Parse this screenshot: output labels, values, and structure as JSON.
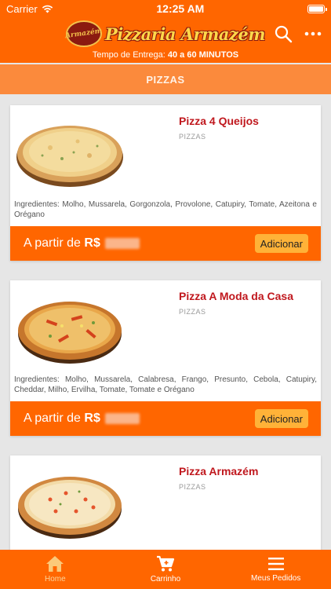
{
  "status_bar": {
    "carrier": "Carrier",
    "time": "12:25 AM"
  },
  "header": {
    "logo_badge_text": "Armazém",
    "logo_text": "Pizzaria Armazém",
    "delivery_label": "Tempo de Entrega:",
    "delivery_time": "40 a 60 MINUTOS"
  },
  "category": {
    "title": "PIZZAS"
  },
  "products": [
    {
      "name": "Pizza 4 Queijos",
      "category": "PIZZAS",
      "ingredients": "Ingredientes: Molho, Mussarela, Gorgonzola, Provolone, Catupiry, Tomate, Azeitona e Orégano",
      "price_prefix": "A partir de",
      "currency": "R$",
      "add_label": "Adicionar"
    },
    {
      "name": "Pizza A Moda da Casa",
      "category": "PIZZAS",
      "ingredients": "Ingredientes: Molho, Mussarela, Calabresa, Frango, Presunto, Cebola, Catupiry, Cheddar, Milho, Ervilha, Tomate, Tomate e Orégano",
      "price_prefix": "A partir de",
      "currency": "R$",
      "add_label": "Adicionar"
    },
    {
      "name": "Pizza Armazém",
      "category": "PIZZAS"
    }
  ],
  "tabs": [
    {
      "label": "Home",
      "icon": "home-icon",
      "active": true
    },
    {
      "label": "Carrinho",
      "icon": "cart-icon",
      "active": false
    },
    {
      "label": "Meus Pedidos",
      "icon": "list-icon",
      "active": false
    }
  ],
  "colors": {
    "primary": "#ff6600",
    "category_bar": "#fb8a3c",
    "product_name": "#c0181e",
    "add_button": "#ffb238"
  }
}
